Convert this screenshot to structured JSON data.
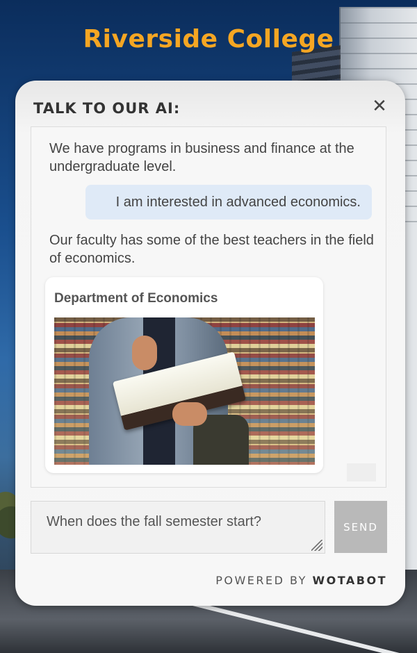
{
  "app": {
    "brand_title": "Riverside College",
    "brand_color": "#f5a623"
  },
  "chat": {
    "title": "TALK TO OUR AI:",
    "close_icon": "close-icon",
    "messages": [
      {
        "role": "bot",
        "text": "We have programs in business and finance at the undergraduate level."
      },
      {
        "role": "user",
        "text": "I am interested in advanced economics."
      },
      {
        "role": "bot",
        "text": "Our faculty has some of the best teachers in the field of economics."
      }
    ],
    "card": {
      "title": "Department of Economics",
      "image": "student-reading-book-in-library"
    },
    "input": {
      "value": "When does the fall semester start?"
    },
    "send_label": "SEND",
    "powered_prefix": "POWERED BY",
    "powered_brand": "WOTABOT",
    "user_bubble_color": "#dfeaf7"
  }
}
